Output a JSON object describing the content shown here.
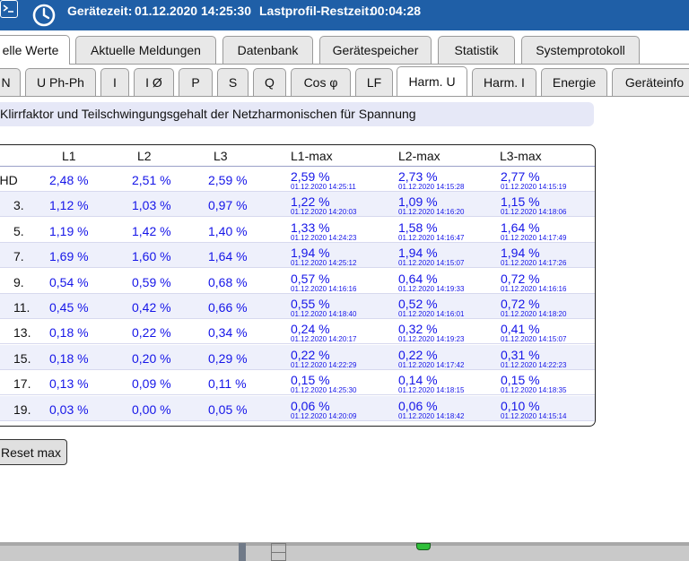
{
  "header": {
    "terminal_icon": "terminal-icon",
    "clock_icon": "clock-icon",
    "device_time_label": "Gerätezeit:",
    "device_time": "01.12.2020 14:25:30",
    "profile_label": "Lastprofil-Restzeit:",
    "profile_time": "00:04:28",
    "color": "#1f5fa7"
  },
  "tabs_main": [
    "elle Werte",
    "Aktuelle Meldungen",
    "Datenbank",
    "Gerätespeicher",
    "Statistik",
    "Systemprotokoll"
  ],
  "tabs_sub": [
    "N",
    "U Ph-Ph",
    "I",
    "I Ø",
    "P",
    "S",
    "Q",
    "Cos φ",
    "LF",
    "Harm. U",
    "Harm. I",
    "Energie",
    "Geräteinfo"
  ],
  "active_main_tab": "elle Werte",
  "active_sub_tab": "Harm. U",
  "section_title": "Klirrfaktor und Teilschwingungsgehalt der Netzharmonischen für Spannung",
  "table": {
    "columns": [
      "L1",
      "L2",
      "L3",
      "L1-max",
      "L2-max",
      "L3-max"
    ],
    "rows": [
      {
        "label": "THD",
        "l1": "2,48 %",
        "l2": "2,51 %",
        "l3": "2,59 %",
        "l1max": "2,59 %",
        "l1ts": "01.12.2020 14:25:11",
        "l2max": "2,73 %",
        "l2ts": "01.12.2020 14:15:28",
        "l3max": "2,77 %",
        "l3ts": "01.12.2020 14:15:19"
      },
      {
        "label": "3.",
        "l1": "1,12 %",
        "l2": "1,03 %",
        "l3": "0,97 %",
        "l1max": "1,22 %",
        "l1ts": "01.12.2020 14:20:03",
        "l2max": "1,09 %",
        "l2ts": "01.12.2020 14:16:20",
        "l3max": "1,15 %",
        "l3ts": "01.12.2020 14:18:06"
      },
      {
        "label": "5.",
        "l1": "1,19 %",
        "l2": "1,42 %",
        "l3": "1,40 %",
        "l1max": "1,33 %",
        "l1ts": "01.12.2020 14:24:23",
        "l2max": "1,58 %",
        "l2ts": "01.12.2020 14:16:47",
        "l3max": "1,64 %",
        "l3ts": "01.12.2020 14:17:49"
      },
      {
        "label": "7.",
        "l1": "1,69 %",
        "l2": "1,60 %",
        "l3": "1,64 %",
        "l1max": "1,94 %",
        "l1ts": "01.12.2020 14:25:12",
        "l2max": "1,94 %",
        "l2ts": "01.12.2020 14:15:07",
        "l3max": "1,94 %",
        "l3ts": "01.12.2020 14:17:26"
      },
      {
        "label": "9.",
        "l1": "0,54 %",
        "l2": "0,59 %",
        "l3": "0,68 %",
        "l1max": "0,57 %",
        "l1ts": "01.12.2020 14:16:16",
        "l2max": "0,64 %",
        "l2ts": "01.12.2020 14:19:33",
        "l3max": "0,72 %",
        "l3ts": "01.12.2020 14:16:16"
      },
      {
        "label": "11.",
        "l1": "0,45 %",
        "l2": "0,42 %",
        "l3": "0,66 %",
        "l1max": "0,55 %",
        "l1ts": "01.12.2020 14:18:40",
        "l2max": "0,52 %",
        "l2ts": "01.12.2020 14:16:01",
        "l3max": "0,72 %",
        "l3ts": "01.12.2020 14:18:20"
      },
      {
        "label": "13.",
        "l1": "0,18 %",
        "l2": "0,22 %",
        "l3": "0,34 %",
        "l1max": "0,24 %",
        "l1ts": "01.12.2020 14:20:17",
        "l2max": "0,32 %",
        "l2ts": "01.12.2020 14:19:23",
        "l3max": "0,41 %",
        "l3ts": "01.12.2020 14:15:07"
      },
      {
        "label": "15.",
        "l1": "0,18 %",
        "l2": "0,20 %",
        "l3": "0,29 %",
        "l1max": "0,22 %",
        "l1ts": "01.12.2020 14:22:29",
        "l2max": "0,22 %",
        "l2ts": "01.12.2020 14:17:42",
        "l3max": "0,31 %",
        "l3ts": "01.12.2020 14:22:23"
      },
      {
        "label": "17.",
        "l1": "0,13 %",
        "l2": "0,09 %",
        "l3": "0,11 %",
        "l1max": "0,15 %",
        "l1ts": "01.12.2020 14:25:30",
        "l2max": "0,14 %",
        "l2ts": "01.12.2020 14:18:15",
        "l3max": "0,15 %",
        "l3ts": "01.12.2020 14:18:35"
      },
      {
        "label": "19.",
        "l1": "0,03 %",
        "l2": "0,00 %",
        "l3": "0,05 %",
        "l1max": "0,06 %",
        "l1ts": "01.12.2020 14:20:09",
        "l2max": "0,06 %",
        "l2ts": "01.12.2020 14:18:42",
        "l3max": "0,10 %",
        "l3ts": "01.12.2020 14:15:14"
      }
    ],
    "value_color": "#1515e8"
  },
  "reset_button": "Reset max"
}
